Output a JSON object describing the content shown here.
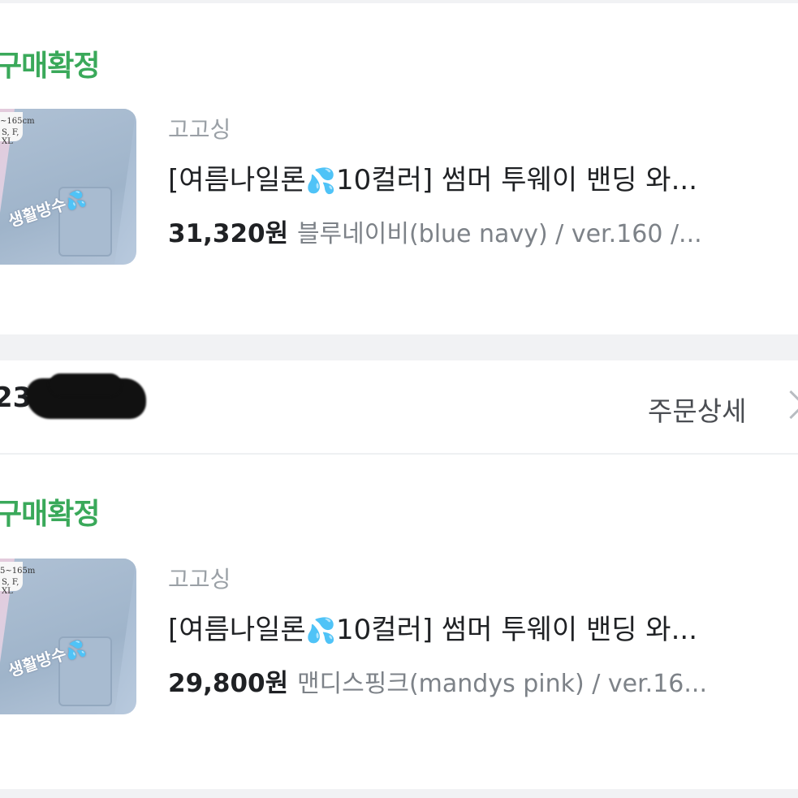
{
  "orders": [
    {
      "status": "구매확정",
      "seller": "고고싱",
      "title": {
        "before": "[여름나일론",
        "drop": "💦",
        "after": "10컬러] 썸머 투웨이 밴딩 와..."
      },
      "price": "31,320원",
      "option": "블루네이비(blue navy) / ver.160 /...",
      "thumb": {
        "size_range": "~165cm",
        "sizes": "S, F, XL",
        "watermark": "생활방수",
        "watermark_emoji": "💦"
      }
    },
    {
      "status": "구매확정",
      "seller": "고고싱",
      "title": {
        "before": "[여름나일론",
        "drop": "💦",
        "after": "10컬러] 썸머 투웨이 밴딩 와..."
      },
      "price": "29,800원",
      "option": "맨디스핑크(mandys pink) / ver.16...",
      "thumb": {
        "size_range": "5~165m",
        "sizes": "S, F, XL",
        "watermark": "생활방수",
        "watermark_emoji": "💦"
      }
    }
  ],
  "order_header": {
    "order_number_visible": "23.",
    "detail_link": "주문상세",
    "chevron_icon": "chevron-right-icon"
  },
  "colors": {
    "status_green": "#3aa95a",
    "background": "#f1f2f4"
  }
}
